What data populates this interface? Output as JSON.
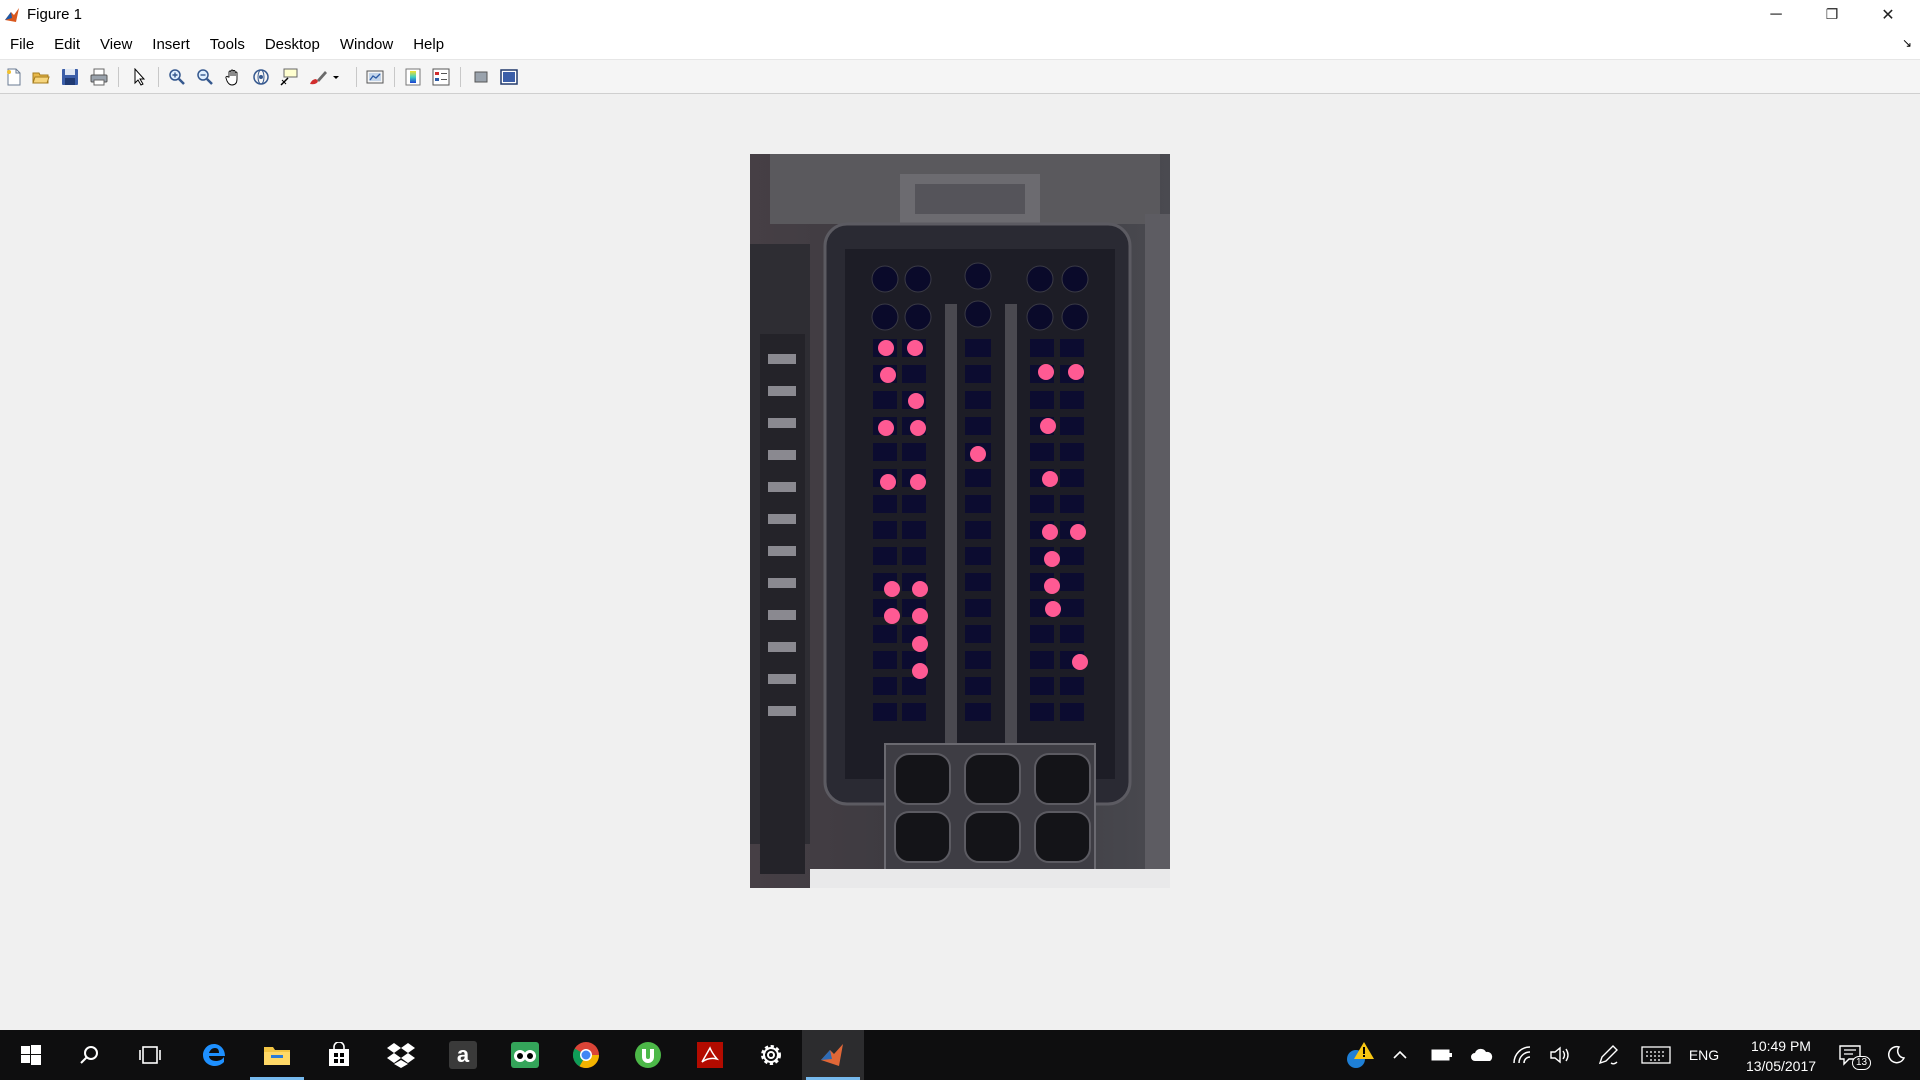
{
  "window": {
    "title": "Figure 1",
    "controls": {
      "minimize": "─",
      "restore": "❐",
      "close": "✕"
    }
  },
  "menu": {
    "items": [
      "File",
      "Edit",
      "View",
      "Insert",
      "Tools",
      "Desktop",
      "Window",
      "Help"
    ],
    "dock_arrow": "↘"
  },
  "toolbar": {
    "icons": [
      "new-figure-icon",
      "open-file-icon",
      "save-figure-icon",
      "print-figure-icon",
      "edit-plot-arrow-icon",
      "zoom-in-icon",
      "zoom-out-icon",
      "pan-hand-icon",
      "rotate-3d-icon",
      "data-cursor-icon",
      "brush-icon",
      "link-plot-icon",
      "insert-colorbar-icon",
      "insert-legend-icon",
      "hide-plot-tools-icon",
      "show-plot-tools-icon"
    ]
  },
  "figure": {
    "image_description": "connector"
  },
  "taskbar": {
    "apps": [
      "start-icon",
      "search-icon",
      "task-view-icon",
      "edge-icon",
      "file-explorer-icon",
      "store-icon",
      "dropbox-icon",
      "amazon-icon",
      "tripadvisor-icon",
      "chrome-icon",
      "utorrent-icon",
      "acrobat-icon",
      "settings-icon",
      "matlab-icon"
    ],
    "amazon_letter": "a",
    "tray": {
      "language": "ENG",
      "time": "10:49 PM",
      "date": "13/05/2017",
      "notifications": "13"
    }
  },
  "colors": {
    "taskbar": "#0e0e0f",
    "accent": "#76b9ed",
    "pin_pink": "#ff5a93",
    "connector_dark": "#2a2a33"
  }
}
